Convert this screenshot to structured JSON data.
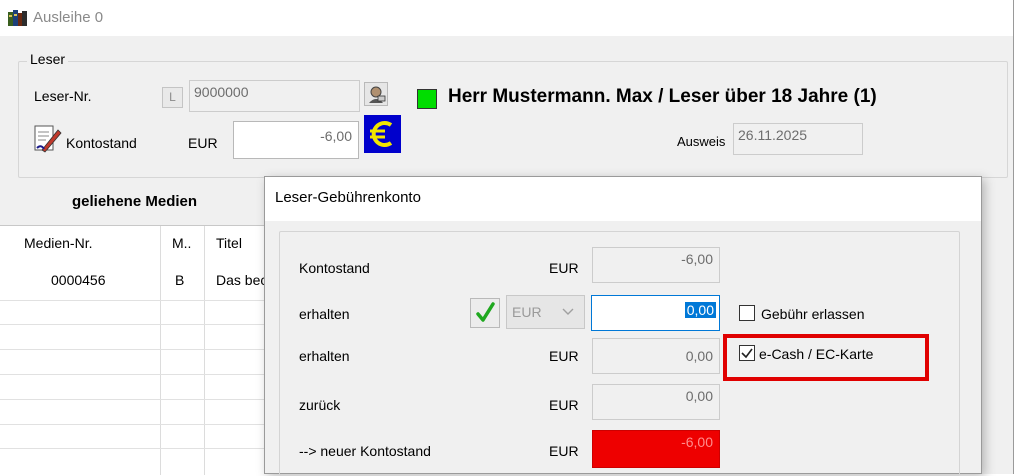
{
  "window": {
    "title": "Ausleihe 0"
  },
  "leser": {
    "group_title": "Leser",
    "lesernr_label": "Leser-Nr.",
    "l_button": "L",
    "lesernr_value": "9000000",
    "status_color": "#00dd00",
    "name_text": "Herr Mustermann. Max / Leser über 18 Jahre (1)",
    "kontostand_label": "Kontostand",
    "currency": "EUR",
    "kontostand_value": "-6,00",
    "ausweis_label": "Ausweis",
    "ausweis_value": "26.11.2025"
  },
  "medien": {
    "heading": "geliehene Medien",
    "columns": [
      "Medien-Nr.",
      "M..",
      "Titel"
    ],
    "rows": [
      {
        "nr": "0000456",
        "m": "B",
        "titel": "Das bec"
      }
    ]
  },
  "dialog": {
    "title": "Leser-Gebührenkonto",
    "rows": {
      "kontostand": {
        "label": "Kontostand",
        "currency": "EUR",
        "value": "-6,00"
      },
      "erhalten1": {
        "label": "erhalten",
        "currency": "EUR",
        "value": "0,00"
      },
      "erhalten2": {
        "label": "erhalten",
        "currency": "EUR",
        "value": "0,00"
      },
      "zurueck": {
        "label": "zurück",
        "currency": "EUR",
        "value": "0,00"
      },
      "neuer": {
        "label": "--> neuer Kontostand",
        "currency": "EUR",
        "value": "-6,00"
      }
    },
    "gebuehr_erlassen": {
      "label": "Gebühr erlassen",
      "checked": false
    },
    "ecash": {
      "label": "e-Cash / EC-Karte",
      "checked": true
    },
    "highlight_color": "#e00000",
    "negative_color": "#ee0000"
  }
}
